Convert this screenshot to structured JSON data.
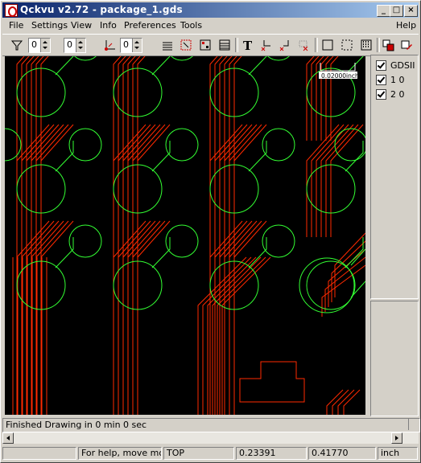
{
  "window": {
    "title": "Qckvu v2.72 - package_1.gds"
  },
  "menu": {
    "file": "File",
    "settings": "Settings",
    "view": "View",
    "info": "Info",
    "preferences": "Preferences",
    "tools": "Tools",
    "help": "Help"
  },
  "toolbar": {
    "spin1": "0",
    "spin2": "0",
    "spin3": "0"
  },
  "scale_label": "0.02000inch",
  "layers": [
    {
      "label": "GDSII"
    },
    {
      "label": "1 0"
    },
    {
      "label": "2 0"
    }
  ],
  "colors": {
    "layer1": "#ff2a00",
    "layer2": "#33ff33",
    "canvas": "#000000"
  },
  "status": {
    "message": "Finished Drawing in 0 min 0 sec",
    "help": "For help, move mous",
    "cell": "TOP",
    "x": "0.23391",
    "y": "0.41770",
    "units": "inch"
  }
}
